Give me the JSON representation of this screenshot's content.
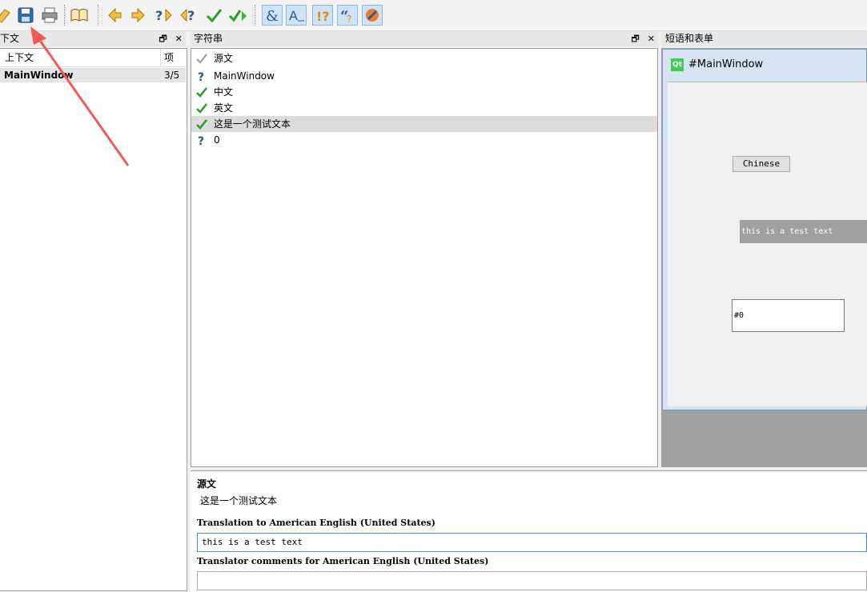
{
  "toolbar": {
    "buttons": [
      "open-icon",
      "save-icon",
      "print-icon",
      "phrasebook-icon",
      "prev-icon",
      "next-icon",
      "prev-unfinished-icon",
      "next-unfinished-icon",
      "done-icon",
      "done-next-icon",
      "accelerator-icon",
      "surrounding-whitespace-icon",
      "punctuation-icon",
      "phrase-match-icon",
      "placemarker-icon"
    ]
  },
  "context_dock": {
    "title": "下文",
    "col_context": "上下文",
    "col_items": "项",
    "rows": [
      {
        "name": "MainWindow",
        "count": "3/5"
      }
    ]
  },
  "strings_dock": {
    "title": "字符串",
    "rows": [
      {
        "text": "源文",
        "status": "header"
      },
      {
        "text": "MainWindow",
        "status": "unfinished"
      },
      {
        "text": "中文",
        "status": "done"
      },
      {
        "text": "英文",
        "status": "done"
      },
      {
        "text": "这是一个测试文本",
        "status": "done"
      },
      {
        "text": "0",
        "status": "unfinished"
      }
    ]
  },
  "phrases_dock": {
    "title": "短语和表单",
    "form_title": "#MainWindow",
    "qt_badge": "Qt",
    "button_label": "Chinese",
    "label_text": "this is a test text",
    "edit_text": "#0"
  },
  "editor": {
    "source_label": "源文",
    "source_text": "这是一个测试文本",
    "translation_label": "Translation to American English (United States)",
    "translation_value": "this is a test text",
    "comments_label": "Translator comments for American English (United States)",
    "comments_value": ""
  },
  "dock_buttons": {
    "float": "🗗",
    "close": "✕"
  },
  "colors": {
    "accent_check": "#2a9d2a",
    "annotation_arrow": "#f05a5a"
  }
}
